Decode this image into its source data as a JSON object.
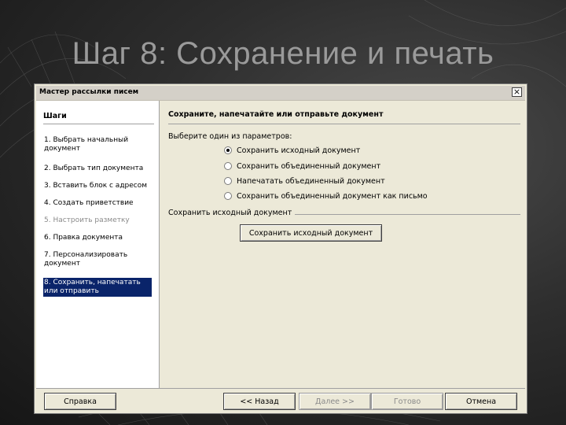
{
  "slide": {
    "title": "Шаг 8: Сохранение и печать"
  },
  "dialog": {
    "title": "Мастер рассылки писем",
    "close_glyph": "×",
    "steps_heading": "Шаги",
    "steps": [
      {
        "label": "1. Выбрать начальный документ",
        "state": "normal"
      },
      {
        "label": "2. Выбрать тип документа",
        "state": "normal"
      },
      {
        "label": "3. Вставить блок с адресом",
        "state": "normal"
      },
      {
        "label": "4. Создать приветствие",
        "state": "normal"
      },
      {
        "label": "5. Настроить разметку",
        "state": "disabled"
      },
      {
        "label": "6. Правка документа",
        "state": "normal"
      },
      {
        "label": "7. Персонализировать документ",
        "state": "normal"
      },
      {
        "label": "8. Сохранить, напечатать или отправить",
        "state": "active"
      }
    ],
    "content_heading": "Сохраните, напечатайте или отправьте документ",
    "choose_label": "Выберите один из параметров:",
    "options": [
      {
        "label": "Сохранить исходный документ",
        "checked": true
      },
      {
        "label": "Сохранить объединенный документ",
        "checked": false
      },
      {
        "label": "Напечатать объединенный документ",
        "checked": false
      },
      {
        "label": "Сохранить объединенный документ как письмо",
        "checked": false
      }
    ],
    "group_label": "Сохранить исходный документ",
    "save_button": "Сохранить исходный документ",
    "buttons": {
      "help": "Справка",
      "back": "<< Назад",
      "next": "Далее >>",
      "finish": "Готово",
      "cancel": "Отмена"
    }
  }
}
